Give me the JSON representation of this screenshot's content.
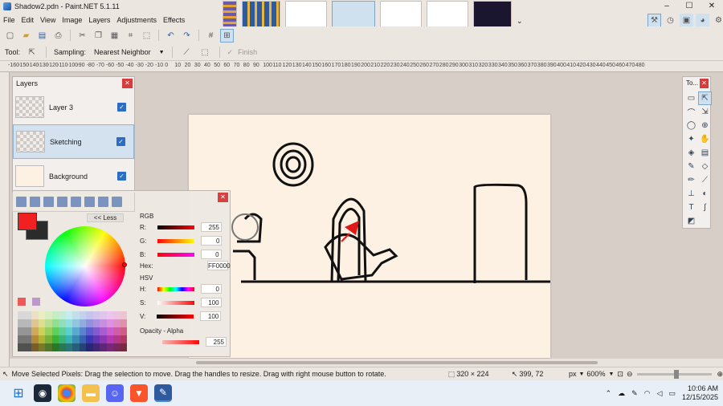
{
  "window": {
    "title": "Shadow2.pdn - Paint.NET 5.1.11",
    "minimize": "–",
    "maximize": "☐",
    "close": "✕"
  },
  "menu": [
    "File",
    "Edit",
    "View",
    "Image",
    "Layers",
    "Adjustments",
    "Effects"
  ],
  "toolbar2": {
    "tool_label": "Tool:",
    "sampling_label": "Sampling:",
    "sampling_value": "Nearest Neighbor",
    "finish_label": "Finish"
  },
  "ruler": {
    "ticks": [
      "-160",
      "-150",
      "-140",
      "-130",
      "-120",
      "-110",
      "-100",
      "-90",
      "-80",
      "-70",
      "-60",
      "-50",
      "-40",
      "-30",
      "-20",
      "-10",
      "0",
      "10",
      "20",
      "30",
      "40",
      "50",
      "60",
      "70",
      "80",
      "90",
      "100",
      "110",
      "120",
      "130",
      "140",
      "150",
      "160",
      "170",
      "180",
      "190",
      "200",
      "210",
      "220",
      "230",
      "240",
      "250",
      "260",
      "270",
      "280",
      "290",
      "300",
      "310",
      "320",
      "330",
      "340",
      "350",
      "360",
      "370",
      "380",
      "390",
      "400",
      "410",
      "420",
      "430",
      "440",
      "450",
      "460",
      "470",
      "480"
    ]
  },
  "layers": {
    "title": "Layers",
    "items": [
      {
        "name": "Layer 3",
        "checked": "✓"
      },
      {
        "name": "Sketching",
        "checked": "✓"
      },
      {
        "name": "Background",
        "checked": "✓"
      }
    ]
  },
  "colors": {
    "less_label": "<< Less",
    "rgb_label": "RGB",
    "hex_label": "Hex:",
    "hex_value": "FF0000",
    "hsv_label": "HSV",
    "opacity_label": "Opacity - Alpha",
    "r": {
      "label": "R:",
      "value": "255"
    },
    "g": {
      "label": "G:",
      "value": "0"
    },
    "b": {
      "label": "B:",
      "value": "0"
    },
    "h": {
      "label": "H:",
      "value": "0"
    },
    "s": {
      "label": "S:",
      "value": "100"
    },
    "v": {
      "label": "V:",
      "value": "100"
    },
    "alpha": "255",
    "primary": "#f31c1c",
    "secondary": "#262626"
  },
  "tools": {
    "title": "To..."
  },
  "status": {
    "message": "Move Selected Pixels: Drag the selection to move. Drag the handles to resize. Drag with right mouse button to rotate.",
    "size": "320 × 224",
    "position": "399, 72",
    "unit": "px",
    "zoom": "600%"
  },
  "clock": {
    "time": "10:06 AM",
    "date": "12/15/2025"
  }
}
